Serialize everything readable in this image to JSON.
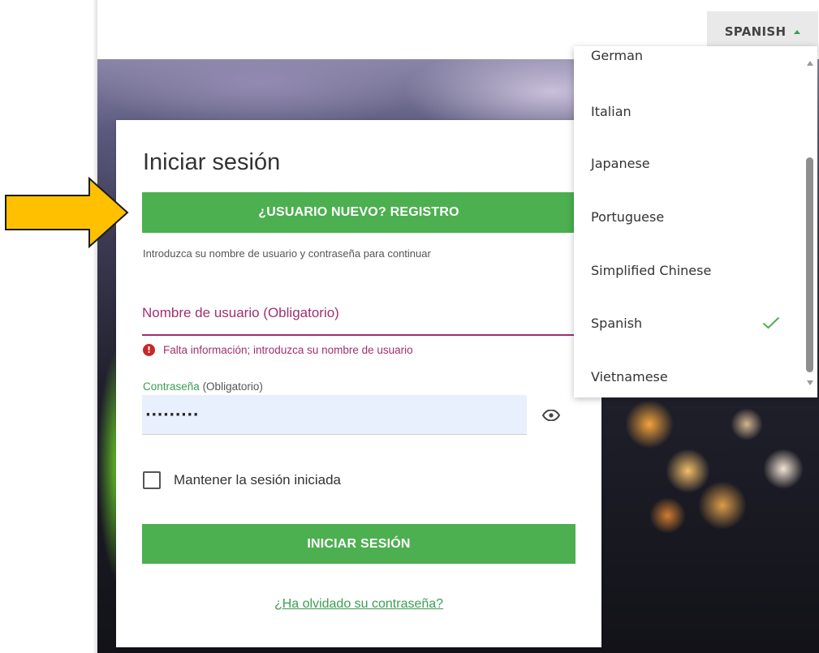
{
  "header": {
    "language_button_label": "SPANISH"
  },
  "login": {
    "title": "Iniciar sesión",
    "register_button": "¿USUARIO NUEVO? REGISTRO",
    "intro_text": "Introduzca su nombre de usuario y contraseña para continuar",
    "username_label": "Nombre de usuario  (Obligatorio)",
    "username_error": "Falta información; introduzca su nombre de usuario",
    "password_label": "Contraseña",
    "password_required": "(Obligatorio)",
    "password_value": "·········",
    "remember_label": "Mantener la sesión iniciada",
    "remember_checked": false,
    "login_button": "INICIAR SESIÓN",
    "forgot_link": "¿Ha olvidado su contraseña?"
  },
  "language_menu": {
    "items": [
      {
        "label": "German",
        "selected": false
      },
      {
        "label": "Italian",
        "selected": false
      },
      {
        "label": "Japanese",
        "selected": false
      },
      {
        "label": "Portuguese",
        "selected": false
      },
      {
        "label": "Simplified Chinese",
        "selected": false
      },
      {
        "label": "Spanish",
        "selected": true
      },
      {
        "label": "Vietnamese",
        "selected": false
      }
    ]
  },
  "colors": {
    "accent_green": "#4caf50",
    "error_magenta": "#a0306f",
    "arrow_yellow": "#ffc000"
  },
  "icons": {
    "language_caret": "caret-up-icon",
    "error": "error-circle-icon",
    "password_toggle": "eye-icon",
    "selected_check": "checkmark-icon",
    "annotation": "arrow-right-icon"
  }
}
